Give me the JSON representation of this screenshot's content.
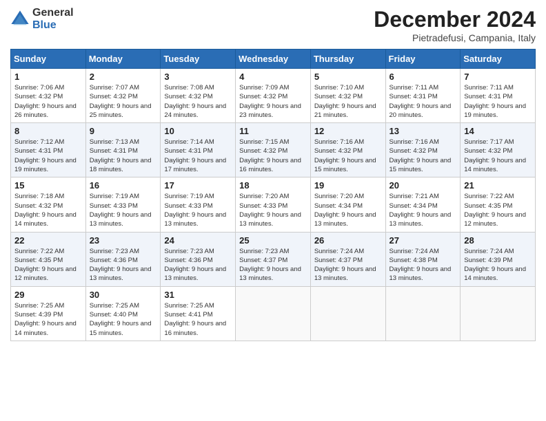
{
  "logo": {
    "general": "General",
    "blue": "Blue"
  },
  "title": "December 2024",
  "location": "Pietradefusi, Campania, Italy",
  "weekdays": [
    "Sunday",
    "Monday",
    "Tuesday",
    "Wednesday",
    "Thursday",
    "Friday",
    "Saturday"
  ],
  "weeks": [
    [
      {
        "day": "1",
        "sunrise": "7:06 AM",
        "sunset": "4:32 PM",
        "daylight": "9 hours and 26 minutes."
      },
      {
        "day": "2",
        "sunrise": "7:07 AM",
        "sunset": "4:32 PM",
        "daylight": "9 hours and 25 minutes."
      },
      {
        "day": "3",
        "sunrise": "7:08 AM",
        "sunset": "4:32 PM",
        "daylight": "9 hours and 24 minutes."
      },
      {
        "day": "4",
        "sunrise": "7:09 AM",
        "sunset": "4:32 PM",
        "daylight": "9 hours and 23 minutes."
      },
      {
        "day": "5",
        "sunrise": "7:10 AM",
        "sunset": "4:32 PM",
        "daylight": "9 hours and 21 minutes."
      },
      {
        "day": "6",
        "sunrise": "7:11 AM",
        "sunset": "4:31 PM",
        "daylight": "9 hours and 20 minutes."
      },
      {
        "day": "7",
        "sunrise": "7:11 AM",
        "sunset": "4:31 PM",
        "daylight": "9 hours and 19 minutes."
      }
    ],
    [
      {
        "day": "8",
        "sunrise": "7:12 AM",
        "sunset": "4:31 PM",
        "daylight": "9 hours and 19 minutes."
      },
      {
        "day": "9",
        "sunrise": "7:13 AM",
        "sunset": "4:31 PM",
        "daylight": "9 hours and 18 minutes."
      },
      {
        "day": "10",
        "sunrise": "7:14 AM",
        "sunset": "4:31 PM",
        "daylight": "9 hours and 17 minutes."
      },
      {
        "day": "11",
        "sunrise": "7:15 AM",
        "sunset": "4:32 PM",
        "daylight": "9 hours and 16 minutes."
      },
      {
        "day": "12",
        "sunrise": "7:16 AM",
        "sunset": "4:32 PM",
        "daylight": "9 hours and 15 minutes."
      },
      {
        "day": "13",
        "sunrise": "7:16 AM",
        "sunset": "4:32 PM",
        "daylight": "9 hours and 15 minutes."
      },
      {
        "day": "14",
        "sunrise": "7:17 AM",
        "sunset": "4:32 PM",
        "daylight": "9 hours and 14 minutes."
      }
    ],
    [
      {
        "day": "15",
        "sunrise": "7:18 AM",
        "sunset": "4:32 PM",
        "daylight": "9 hours and 14 minutes."
      },
      {
        "day": "16",
        "sunrise": "7:19 AM",
        "sunset": "4:33 PM",
        "daylight": "9 hours and 13 minutes."
      },
      {
        "day": "17",
        "sunrise": "7:19 AM",
        "sunset": "4:33 PM",
        "daylight": "9 hours and 13 minutes."
      },
      {
        "day": "18",
        "sunrise": "7:20 AM",
        "sunset": "4:33 PM",
        "daylight": "9 hours and 13 minutes."
      },
      {
        "day": "19",
        "sunrise": "7:20 AM",
        "sunset": "4:34 PM",
        "daylight": "9 hours and 13 minutes."
      },
      {
        "day": "20",
        "sunrise": "7:21 AM",
        "sunset": "4:34 PM",
        "daylight": "9 hours and 13 minutes."
      },
      {
        "day": "21",
        "sunrise": "7:22 AM",
        "sunset": "4:35 PM",
        "daylight": "9 hours and 12 minutes."
      }
    ],
    [
      {
        "day": "22",
        "sunrise": "7:22 AM",
        "sunset": "4:35 PM",
        "daylight": "9 hours and 12 minutes."
      },
      {
        "day": "23",
        "sunrise": "7:23 AM",
        "sunset": "4:36 PM",
        "daylight": "9 hours and 13 minutes."
      },
      {
        "day": "24",
        "sunrise": "7:23 AM",
        "sunset": "4:36 PM",
        "daylight": "9 hours and 13 minutes."
      },
      {
        "day": "25",
        "sunrise": "7:23 AM",
        "sunset": "4:37 PM",
        "daylight": "9 hours and 13 minutes."
      },
      {
        "day": "26",
        "sunrise": "7:24 AM",
        "sunset": "4:37 PM",
        "daylight": "9 hours and 13 minutes."
      },
      {
        "day": "27",
        "sunrise": "7:24 AM",
        "sunset": "4:38 PM",
        "daylight": "9 hours and 13 minutes."
      },
      {
        "day": "28",
        "sunrise": "7:24 AM",
        "sunset": "4:39 PM",
        "daylight": "9 hours and 14 minutes."
      }
    ],
    [
      {
        "day": "29",
        "sunrise": "7:25 AM",
        "sunset": "4:39 PM",
        "daylight": "9 hours and 14 minutes."
      },
      {
        "day": "30",
        "sunrise": "7:25 AM",
        "sunset": "4:40 PM",
        "daylight": "9 hours and 15 minutes."
      },
      {
        "day": "31",
        "sunrise": "7:25 AM",
        "sunset": "4:41 PM",
        "daylight": "9 hours and 16 minutes."
      },
      null,
      null,
      null,
      null
    ]
  ]
}
